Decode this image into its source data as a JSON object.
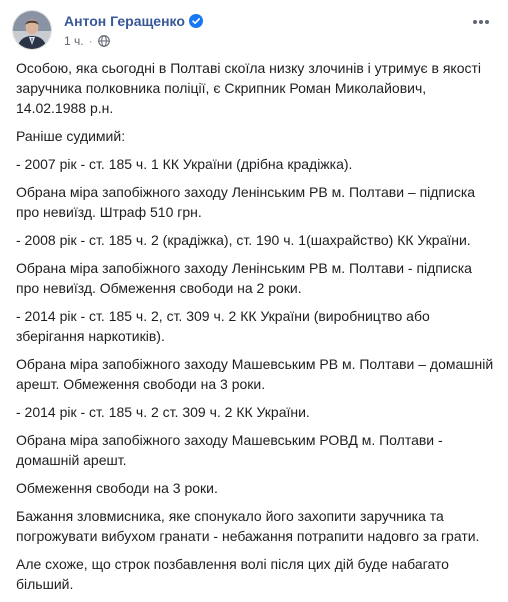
{
  "post": {
    "author": "Антон Геращенко",
    "timestamp": "1 ч.",
    "separator": "·",
    "icons": {
      "verified": "verified-badge-icon",
      "audience": "globe-icon",
      "menu": "more-options-icon"
    },
    "colors": {
      "author_link": "#385898",
      "verified_badge": "#1877f2",
      "meta_text": "#616770",
      "body_text": "#1c1e21"
    },
    "paragraphs": [
      "Особою, яка сьогодні в Полтаві скоїла низку злочинів і утримує в якості заручника полковника поліції, є Скрипник Роман Миколайович, 14.02.1988 р.н.",
      "Раніше судимий:",
      "- 2007 рік - ст. 185 ч. 1 КК України (дрібна крадіжка).",
      "Обрана міра запобіжного заходу Ленінським РВ м. Полтави – підписка про невиїзд. Штраф 510 грн.",
      "- 2008 рік - ст. 185 ч. 2 (крадіжка), ст. 190 ч. 1(шахрайство) КК України.",
      "Обрана міра запобіжного заходу Ленінським РВ м. Полтави - підписка про невиїзд. Обмеження свободи на 2 роки.",
      "- 2014 рік - ст. 185 ч. 2, ст. 309 ч. 2 КК України (виробництво або зберігання наркотиків).",
      "Обрана міра запобіжного заходу Машевським РВ м. Полтави – домашній арешт. Обмеження свободи на 3 роки.",
      "- 2014 рік - ст. 185 ч. 2 ст. 309 ч. 2 КК України.",
      "Обрана міра запобіжного заходу Машевським РОВД м. Полтави - домашній арешт.",
      "Обмеження свободи на 3 роки.",
      "Бажання зловмисника, яке спонукало його захопити заручника та погрожувати вибухом гранати - небажання потрапити надовго за грати.",
      "Але схоже, що строк позбавлення волі після цих дій буде набагато більший."
    ]
  }
}
